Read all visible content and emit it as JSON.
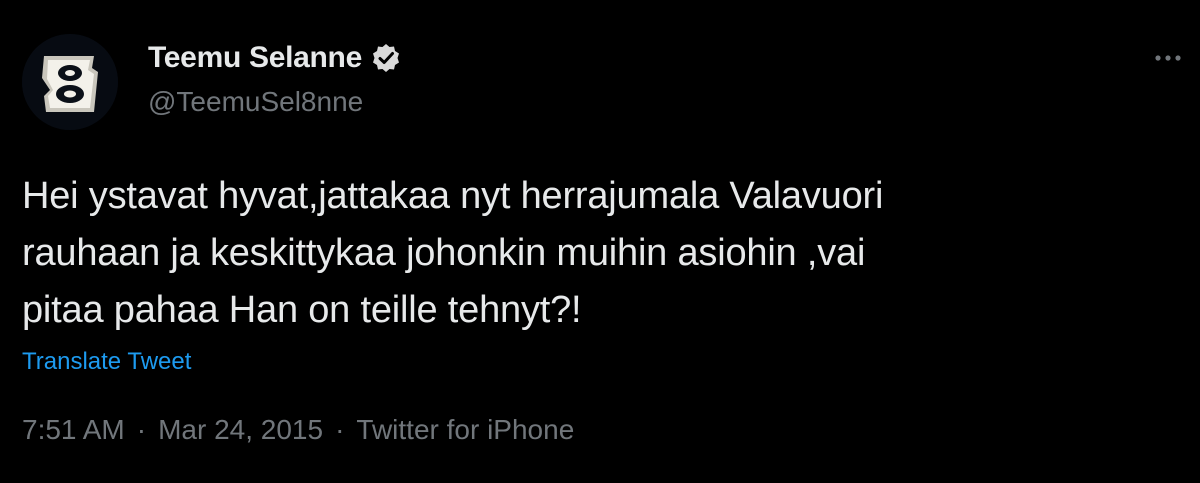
{
  "author": {
    "display_name": "Teemu Selanne",
    "handle": "@TeemuSel8nne",
    "verified": true,
    "avatar_icon": "number-8-logo"
  },
  "tweet": {
    "text": "Hei ystavat hyvat,jattakaa nyt herrajumala Valavuori\nrauhaan ja keskittykaa johonkin muihin asiohin ,vai\npitaa pahaa Han on teille tehnyt?!",
    "translate_label": "Translate Tweet",
    "time": "7:51 AM",
    "date": "Mar 24, 2015",
    "source": "Twitter for iPhone",
    "separator": "·"
  },
  "icons": {
    "more": "more-options-icon",
    "verified": "verified-badge-icon"
  },
  "colors": {
    "background": "#000000",
    "text": "#e7e9ea",
    "secondary": "#71767b",
    "link": "#1d9bf0"
  }
}
